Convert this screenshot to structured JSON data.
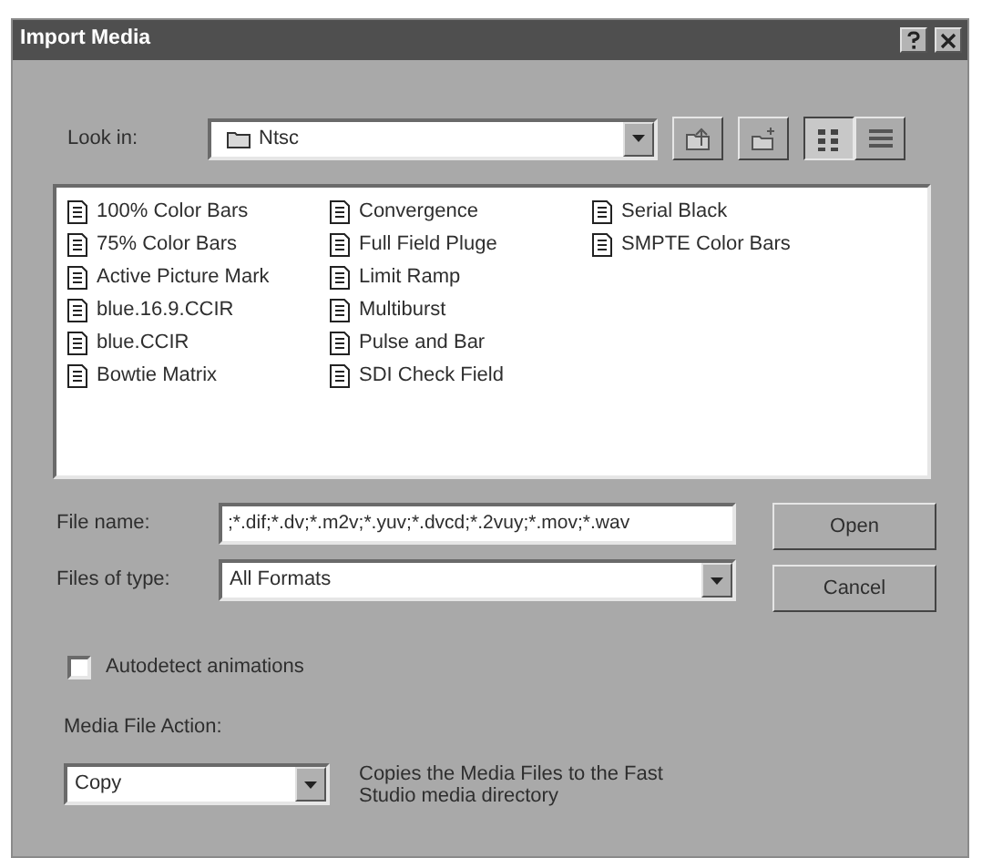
{
  "window": {
    "title": "Import Media"
  },
  "look_in": {
    "label": "Look in:",
    "value": "Ntsc"
  },
  "toolbar_buttons": [
    {
      "kind": "up-folder"
    },
    {
      "kind": "new-folder"
    }
  ],
  "view_buttons": [
    {
      "kind": "list",
      "selected": true
    },
    {
      "kind": "details",
      "selected": false
    }
  ],
  "files": [
    "100% Color Bars",
    "75% Color Bars",
    "Active Picture Mark",
    "blue.16.9.CCIR",
    "blue.CCIR",
    "Bowtie Matrix",
    "Convergence",
    "Full Field Pluge",
    "Limit Ramp",
    "Multiburst",
    "Pulse and Bar",
    "SDI Check Field",
    "Serial Black",
    "SMPTE Color Bars"
  ],
  "file_name": {
    "label": "File name:",
    "value": ";*.dif;*.dv;*.m2v;*.yuv;*.dvcd;*.2vuy;*.mov;*.wav"
  },
  "file_type": {
    "label": "Files of type:",
    "value": "All Formats"
  },
  "buttons": [
    "Open",
    "Cancel"
  ],
  "autodetect": {
    "label": "Autodetect animations",
    "checked": false
  },
  "media_action": {
    "label": "Media File Action:",
    "value": "Copy",
    "description": "Copies the Media Files to the Fast Studio media directory"
  }
}
